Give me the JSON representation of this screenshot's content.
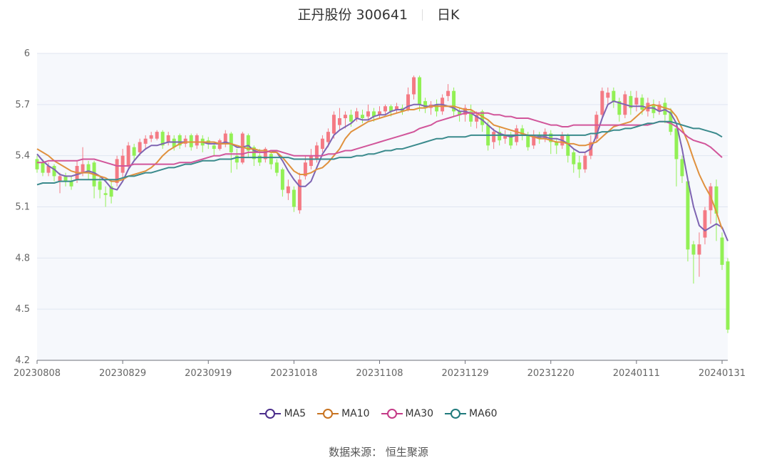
{
  "header": {
    "stock": "正丹股份 300641",
    "period": "日K"
  },
  "source": {
    "label": "数据来源：",
    "name": "恒生聚源"
  },
  "colors": {
    "up": "#f47a84",
    "down": "#92f055",
    "ma5": "#7e64b2",
    "ma10": "#e0913e",
    "ma30": "#d1559a",
    "ma60": "#3a8a8c",
    "grid": "#e0e6f1",
    "plotbg": "#f6f8fc"
  },
  "legend": [
    {
      "name": "MA5",
      "color": "#4b2d8b"
    },
    {
      "name": "MA10",
      "color": "#c87320"
    },
    {
      "name": "MA30",
      "color": "#c43a87"
    },
    {
      "name": "MA60",
      "color": "#1f7a7c"
    }
  ],
  "chart_data": {
    "type": "candlestick",
    "ylim": [
      4.2,
      6.0
    ],
    "yticks": [
      "4.2",
      "4.5",
      "4.8",
      "5.1",
      "5.4",
      "5.7",
      "6"
    ],
    "xticks": [
      {
        "label": "20230808",
        "index": 0
      },
      {
        "label": "20230829",
        "index": 15
      },
      {
        "label": "20230919",
        "index": 30
      },
      {
        "label": "20231018",
        "index": 45
      },
      {
        "label": "20231108",
        "index": 60
      },
      {
        "label": "20231129",
        "index": 75
      },
      {
        "label": "20231220",
        "index": 90
      },
      {
        "label": "20240111",
        "index": 105
      },
      {
        "label": "20240131",
        "index": 120
      }
    ],
    "ohlc": [
      [
        5.38,
        5.32,
        5.4,
        5.3
      ],
      [
        5.36,
        5.3,
        5.38,
        5.28
      ],
      [
        5.3,
        5.34,
        5.36,
        5.28
      ],
      [
        5.34,
        5.28,
        5.35,
        5.25
      ],
      [
        5.25,
        5.28,
        5.3,
        5.18
      ],
      [
        5.28,
        5.25,
        5.3,
        5.22
      ],
      [
        5.25,
        5.22,
        5.28,
        5.2
      ],
      [
        5.26,
        5.34,
        5.37,
        5.24
      ],
      [
        5.3,
        5.35,
        5.45,
        5.28
      ],
      [
        5.35,
        5.3,
        5.37,
        5.26
      ],
      [
        5.36,
        5.22,
        5.37,
        5.15
      ],
      [
        5.25,
        5.2,
        5.28,
        5.15
      ],
      [
        5.18,
        5.17,
        5.22,
        5.1
      ],
      [
        5.22,
        5.16,
        5.26,
        5.12
      ],
      [
        5.24,
        5.38,
        5.4,
        5.22
      ],
      [
        5.3,
        5.4,
        5.44,
        5.27
      ],
      [
        5.34,
        5.46,
        5.48,
        5.32
      ],
      [
        5.45,
        5.4,
        5.47,
        5.37
      ],
      [
        5.42,
        5.48,
        5.5,
        5.4
      ],
      [
        5.47,
        5.5,
        5.52,
        5.44
      ],
      [
        5.5,
        5.52,
        5.54,
        5.48
      ],
      [
        5.5,
        5.54,
        5.55,
        5.49
      ],
      [
        5.54,
        5.46,
        5.55,
        5.44
      ],
      [
        5.48,
        5.52,
        5.54,
        5.46
      ],
      [
        5.5,
        5.45,
        5.52,
        5.43
      ],
      [
        5.52,
        5.46,
        5.53,
        5.44
      ],
      [
        5.47,
        5.5,
        5.52,
        5.45
      ],
      [
        5.52,
        5.45,
        5.53,
        5.43
      ],
      [
        5.46,
        5.52,
        5.53,
        5.44
      ],
      [
        5.5,
        5.46,
        5.52,
        5.42
      ],
      [
        5.49,
        5.47,
        5.51,
        5.44
      ],
      [
        5.46,
        5.44,
        5.48,
        5.4
      ],
      [
        5.44,
        5.49,
        5.5,
        5.43
      ],
      [
        5.47,
        5.53,
        5.55,
        5.45
      ],
      [
        5.53,
        5.42,
        5.54,
        5.3
      ],
      [
        5.4,
        5.36,
        5.44,
        5.32
      ],
      [
        5.36,
        5.53,
        5.54,
        5.35
      ],
      [
        5.52,
        5.43,
        5.53,
        5.39
      ],
      [
        5.45,
        5.38,
        5.46,
        5.34
      ],
      [
        5.4,
        5.36,
        5.44,
        5.34
      ],
      [
        5.38,
        5.44,
        5.45,
        5.36
      ],
      [
        5.41,
        5.35,
        5.42,
        5.32
      ],
      [
        5.36,
        5.3,
        5.38,
        5.28
      ],
      [
        5.32,
        5.2,
        5.33,
        5.16
      ],
      [
        5.18,
        5.22,
        5.26,
        5.14
      ],
      [
        5.2,
        5.1,
        5.22,
        5.07
      ],
      [
        5.08,
        5.26,
        5.3,
        5.06
      ],
      [
        5.28,
        5.36,
        5.4,
        5.26
      ],
      [
        5.34,
        5.4,
        5.44,
        5.32
      ],
      [
        5.38,
        5.46,
        5.48,
        5.36
      ],
      [
        5.44,
        5.5,
        5.52,
        5.42
      ],
      [
        5.48,
        5.54,
        5.56,
        5.45
      ],
      [
        5.53,
        5.64,
        5.66,
        5.5
      ],
      [
        5.58,
        5.62,
        5.68,
        5.55
      ],
      [
        5.62,
        5.64,
        5.66,
        5.56
      ],
      [
        5.64,
        5.6,
        5.67,
        5.57
      ],
      [
        5.62,
        5.66,
        5.68,
        5.6
      ],
      [
        5.64,
        5.62,
        5.67,
        5.59
      ],
      [
        5.63,
        5.66,
        5.7,
        5.61
      ],
      [
        5.66,
        5.63,
        5.68,
        5.6
      ],
      [
        5.64,
        5.66,
        5.69,
        5.62
      ],
      [
        5.66,
        5.69,
        5.7,
        5.64
      ],
      [
        5.69,
        5.66,
        5.7,
        5.63
      ],
      [
        5.67,
        5.69,
        5.71,
        5.65
      ],
      [
        5.68,
        5.66,
        5.7,
        5.64
      ],
      [
        5.67,
        5.76,
        5.8,
        5.66
      ],
      [
        5.76,
        5.86,
        5.87,
        5.73
      ],
      [
        5.86,
        5.7,
        5.87,
        5.66
      ],
      [
        5.72,
        5.68,
        5.74,
        5.65
      ],
      [
        5.68,
        5.7,
        5.72,
        5.64
      ],
      [
        5.7,
        5.66,
        5.73,
        5.63
      ],
      [
        5.66,
        5.74,
        5.76,
        5.64
      ],
      [
        5.75,
        5.78,
        5.82,
        5.72
      ],
      [
        5.78,
        5.66,
        5.8,
        5.63
      ],
      [
        5.66,
        5.64,
        5.68,
        5.6
      ],
      [
        5.64,
        5.68,
        5.7,
        5.6
      ],
      [
        5.66,
        5.6,
        5.7,
        5.57
      ],
      [
        5.6,
        5.64,
        5.66,
        5.56
      ],
      [
        5.66,
        5.58,
        5.67,
        5.54
      ],
      [
        5.58,
        5.46,
        5.6,
        5.43
      ],
      [
        5.48,
        5.54,
        5.56,
        5.44
      ],
      [
        5.54,
        5.49,
        5.57,
        5.46
      ],
      [
        5.5,
        5.52,
        5.55,
        5.47
      ],
      [
        5.52,
        5.46,
        5.54,
        5.44
      ],
      [
        5.48,
        5.56,
        5.58,
        5.46
      ],
      [
        5.56,
        5.52,
        5.58,
        5.49
      ],
      [
        5.52,
        5.45,
        5.54,
        5.43
      ],
      [
        5.46,
        5.52,
        5.55,
        5.44
      ],
      [
        5.52,
        5.5,
        5.54,
        5.47
      ],
      [
        5.5,
        5.54,
        5.56,
        5.48
      ],
      [
        5.53,
        5.48,
        5.55,
        5.41
      ],
      [
        5.48,
        5.46,
        5.5,
        5.41
      ],
      [
        5.46,
        5.52,
        5.54,
        5.44
      ],
      [
        5.52,
        5.4,
        5.53,
        5.36
      ],
      [
        5.42,
        5.35,
        5.44,
        5.3
      ],
      [
        5.36,
        5.32,
        5.4,
        5.27
      ],
      [
        5.32,
        5.4,
        5.42,
        5.3
      ],
      [
        5.4,
        5.48,
        5.52,
        5.38
      ],
      [
        5.5,
        5.64,
        5.66,
        5.48
      ],
      [
        5.64,
        5.78,
        5.8,
        5.62
      ],
      [
        5.74,
        5.77,
        5.8,
        5.7
      ],
      [
        5.78,
        5.72,
        5.8,
        5.68
      ],
      [
        5.72,
        5.64,
        5.74,
        5.6
      ],
      [
        5.64,
        5.76,
        5.78,
        5.62
      ],
      [
        5.75,
        5.68,
        5.78,
        5.64
      ],
      [
        5.7,
        5.74,
        5.78,
        5.66
      ],
      [
        5.74,
        5.67,
        5.76,
        5.64
      ],
      [
        5.66,
        5.71,
        5.74,
        5.63
      ],
      [
        5.7,
        5.65,
        5.73,
        5.62
      ],
      [
        5.66,
        5.7,
        5.72,
        5.64
      ],
      [
        5.71,
        5.64,
        5.74,
        5.59
      ],
      [
        5.66,
        5.54,
        5.68,
        5.52
      ],
      [
        5.56,
        5.38,
        5.58,
        5.22
      ],
      [
        5.38,
        5.28,
        5.4,
        5.24
      ],
      [
        5.25,
        4.85,
        5.27,
        4.78
      ],
      [
        4.88,
        4.82,
        4.9,
        4.65
      ],
      [
        4.82,
        4.88,
        4.95,
        4.69
      ],
      [
        4.92,
        5.08,
        5.1,
        4.88
      ],
      [
        5.08,
        5.22,
        5.24,
        5.0
      ],
      [
        5.22,
        5.06,
        5.26,
        4.9
      ],
      [
        4.92,
        4.76,
        4.95,
        4.73
      ],
      [
        4.78,
        4.38,
        4.8,
        4.36
      ]
    ],
    "series": [
      {
        "name": "MA5",
        "values": [
          5.41,
          5.37,
          5.34,
          5.32,
          5.29,
          5.28,
          5.28,
          5.29,
          5.3,
          5.31,
          5.3,
          5.28,
          5.25,
          5.21,
          5.2,
          5.25,
          5.32,
          5.37,
          5.41,
          5.44,
          5.46,
          5.46,
          5.47,
          5.48,
          5.48,
          5.48,
          5.48,
          5.48,
          5.48,
          5.48,
          5.47,
          5.47,
          5.47,
          5.48,
          5.47,
          5.45,
          5.45,
          5.46,
          5.43,
          5.42,
          5.42,
          5.43,
          5.42,
          5.37,
          5.31,
          5.26,
          5.22,
          5.22,
          5.25,
          5.33,
          5.41,
          5.46,
          5.52,
          5.55,
          5.57,
          5.59,
          5.62,
          5.61,
          5.61,
          5.63,
          5.64,
          5.64,
          5.66,
          5.67,
          5.67,
          5.69,
          5.7,
          5.7,
          5.69,
          5.69,
          5.7,
          5.7,
          5.69,
          5.68,
          5.66,
          5.66,
          5.65,
          5.63,
          5.61,
          5.58,
          5.55,
          5.53,
          5.52,
          5.51,
          5.52,
          5.52,
          5.52,
          5.51,
          5.51,
          5.51,
          5.5,
          5.5,
          5.49,
          5.47,
          5.44,
          5.42,
          5.42,
          5.44,
          5.52,
          5.62,
          5.7,
          5.72,
          5.71,
          5.7,
          5.69,
          5.69,
          5.69,
          5.68,
          5.68,
          5.66,
          5.67,
          5.65,
          5.59,
          5.44,
          5.26,
          5.1,
          4.99,
          4.96,
          4.98,
          5.0,
          4.98,
          4.9
        ]
      },
      {
        "name": "MA10",
        "values": [
          5.44,
          5.42,
          5.4,
          5.37,
          5.35,
          5.33,
          5.31,
          5.3,
          5.3,
          5.3,
          5.29,
          5.28,
          5.27,
          5.25,
          5.25,
          5.26,
          5.28,
          5.29,
          5.3,
          5.31,
          5.33,
          5.36,
          5.4,
          5.43,
          5.45,
          5.47,
          5.48,
          5.48,
          5.48,
          5.48,
          5.48,
          5.48,
          5.47,
          5.47,
          5.47,
          5.46,
          5.45,
          5.44,
          5.44,
          5.43,
          5.43,
          5.42,
          5.42,
          5.39,
          5.35,
          5.31,
          5.29,
          5.29,
          5.3,
          5.32,
          5.33,
          5.36,
          5.4,
          5.44,
          5.5,
          5.54,
          5.56,
          5.58,
          5.6,
          5.61,
          5.62,
          5.63,
          5.64,
          5.65,
          5.66,
          5.67,
          5.67,
          5.68,
          5.68,
          5.69,
          5.69,
          5.69,
          5.69,
          5.69,
          5.68,
          5.67,
          5.67,
          5.65,
          5.63,
          5.61,
          5.58,
          5.57,
          5.56,
          5.55,
          5.54,
          5.53,
          5.52,
          5.51,
          5.5,
          5.5,
          5.49,
          5.48,
          5.48,
          5.47,
          5.47,
          5.46,
          5.46,
          5.47,
          5.48,
          5.51,
          5.54,
          5.57,
          5.58,
          5.59,
          5.6,
          5.63,
          5.66,
          5.69,
          5.7,
          5.69,
          5.68,
          5.67,
          5.63,
          5.56,
          5.48,
          5.38,
          5.29,
          5.22,
          5.16,
          5.07,
          4.97
        ]
      },
      {
        "name": "MA30",
        "values": [
          5.36,
          5.36,
          5.37,
          5.37,
          5.37,
          5.37,
          5.37,
          5.37,
          5.38,
          5.38,
          5.38,
          5.37,
          5.36,
          5.35,
          5.34,
          5.34,
          5.34,
          5.35,
          5.35,
          5.35,
          5.35,
          5.35,
          5.35,
          5.35,
          5.35,
          5.36,
          5.36,
          5.36,
          5.37,
          5.38,
          5.39,
          5.4,
          5.4,
          5.41,
          5.41,
          5.41,
          5.41,
          5.42,
          5.42,
          5.42,
          5.42,
          5.43,
          5.43,
          5.42,
          5.41,
          5.4,
          5.4,
          5.4,
          5.4,
          5.4,
          5.4,
          5.41,
          5.41,
          5.42,
          5.43,
          5.43,
          5.44,
          5.45,
          5.46,
          5.47,
          5.48,
          5.49,
          5.5,
          5.51,
          5.52,
          5.53,
          5.54,
          5.56,
          5.57,
          5.58,
          5.6,
          5.61,
          5.62,
          5.63,
          5.64,
          5.65,
          5.65,
          5.65,
          5.65,
          5.65,
          5.64,
          5.64,
          5.63,
          5.63,
          5.62,
          5.62,
          5.62,
          5.61,
          5.6,
          5.59,
          5.58,
          5.58,
          5.57,
          5.57,
          5.58,
          5.58,
          5.58,
          5.58,
          5.58,
          5.58,
          5.58,
          5.58,
          5.58,
          5.58,
          5.58,
          5.58,
          5.58,
          5.58,
          5.59,
          5.6,
          5.6,
          5.59,
          5.57,
          5.54,
          5.51,
          5.49,
          5.48,
          5.47,
          5.45,
          5.42,
          5.39
        ]
      },
      {
        "name": "MA60",
        "values": [
          5.23,
          5.24,
          5.24,
          5.24,
          5.25,
          5.25,
          5.25,
          5.26,
          5.26,
          5.26,
          5.26,
          5.26,
          5.26,
          5.26,
          5.26,
          5.27,
          5.28,
          5.28,
          5.29,
          5.3,
          5.3,
          5.31,
          5.32,
          5.33,
          5.33,
          5.34,
          5.35,
          5.35,
          5.36,
          5.37,
          5.37,
          5.37,
          5.38,
          5.38,
          5.38,
          5.39,
          5.39,
          5.39,
          5.39,
          5.39,
          5.39,
          5.39,
          5.39,
          5.39,
          5.39,
          5.38,
          5.38,
          5.38,
          5.38,
          5.38,
          5.38,
          5.38,
          5.38,
          5.39,
          5.39,
          5.39,
          5.4,
          5.4,
          5.41,
          5.41,
          5.42,
          5.43,
          5.43,
          5.44,
          5.44,
          5.45,
          5.46,
          5.47,
          5.48,
          5.49,
          5.5,
          5.5,
          5.51,
          5.51,
          5.51,
          5.51,
          5.52,
          5.52,
          5.52,
          5.52,
          5.52,
          5.52,
          5.52,
          5.52,
          5.52,
          5.52,
          5.52,
          5.52,
          5.52,
          5.52,
          5.52,
          5.52,
          5.52,
          5.52,
          5.52,
          5.52,
          5.52,
          5.53,
          5.53,
          5.54,
          5.54,
          5.55,
          5.55,
          5.56,
          5.56,
          5.57,
          5.58,
          5.59,
          5.59,
          5.6,
          5.6,
          5.6,
          5.59,
          5.58,
          5.57,
          5.56,
          5.56,
          5.55,
          5.54,
          5.53,
          5.51
        ]
      }
    ]
  }
}
